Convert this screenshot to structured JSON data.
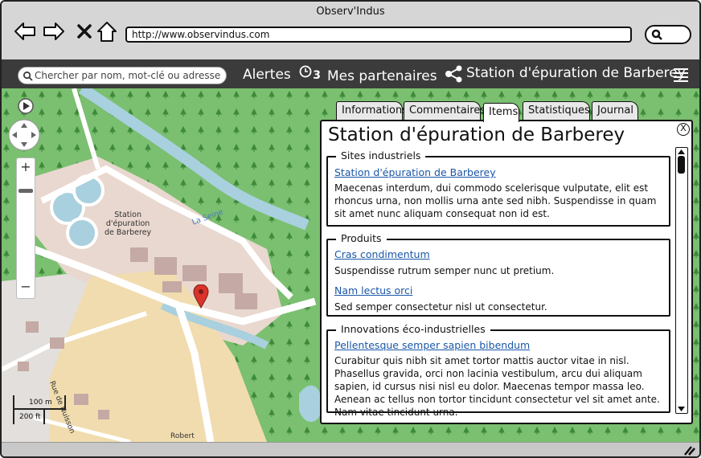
{
  "window": {
    "title": "Observ'Indus",
    "url": "http://www.observindus.com"
  },
  "appbar": {
    "search_placeholder": "Chercher par nom, mot-clé ou adresse",
    "alerts_label": "Alertes",
    "alerts_count": "3",
    "partners_label": "Mes partenaires",
    "station_label": "Station d'épuration de Barberey"
  },
  "map": {
    "place_label": [
      "Station",
      "d'épuration",
      "de Barberey"
    ],
    "river_label": "La Seine",
    "street_label": "Rue de Nuisson",
    "street_label2": "Robert",
    "scale_top": "100 m",
    "scale_bottom": "200 ft"
  },
  "tabs": [
    "Informations",
    "Commentaires",
    "Items",
    "Statistiques",
    "Journal"
  ],
  "active_tab": "Items",
  "panel": {
    "title": "Station d'épuration de Barberey",
    "close": "X",
    "sections": [
      {
        "legend": "Sites industriels",
        "items": [
          {
            "link": "Station d'épuration de Barberey",
            "text": "Maecenas interdum, dui commodo scelerisque vulputate, elit est rhoncus urna, non mollis urna ante sed nibh. Suspendisse in quam sit amet nunc aliquam consequat non id est."
          }
        ]
      },
      {
        "legend": "Produits",
        "items": [
          {
            "link": "Cras condimentum",
            "text": "Suspendisse rutrum semper nunc ut pretium."
          },
          {
            "link": "Nam lectus orci",
            "text": "Sed semper consectetur nisl ut consectetur."
          }
        ]
      },
      {
        "legend": "Innovations éco-industrielles",
        "items": [
          {
            "link": "Pellentesque semper sapien bibendum",
            "text": "Curabitur quis nibh sit amet tortor mattis auctor vitae in nisl. Phasellus gravida, orci non lacinia vestibulum, arcu dui aliquam sapien, id cursus nisi nisl eu dolor. Maecenas tempor massa leo. Aenean ac tellus non tortor tincidunt consectetur vel sit amet ante. Nam vitae tincidunt urna."
          }
        ]
      }
    ]
  },
  "icons": [
    "back-icon",
    "forward-icon",
    "close-x-icon",
    "home-icon",
    "search-icon",
    "clock-icon",
    "share-icon",
    "hamburger-menu-icon",
    "play-icon",
    "pan-icon",
    "zoom-in-icon",
    "zoom-out-icon",
    "map-marker-icon",
    "resize-grip-icon"
  ],
  "colors": {
    "appbar": "#3b3b3b",
    "map_green": "#77bd6e",
    "link": "#1a57a8",
    "marker": "#d9332b"
  }
}
